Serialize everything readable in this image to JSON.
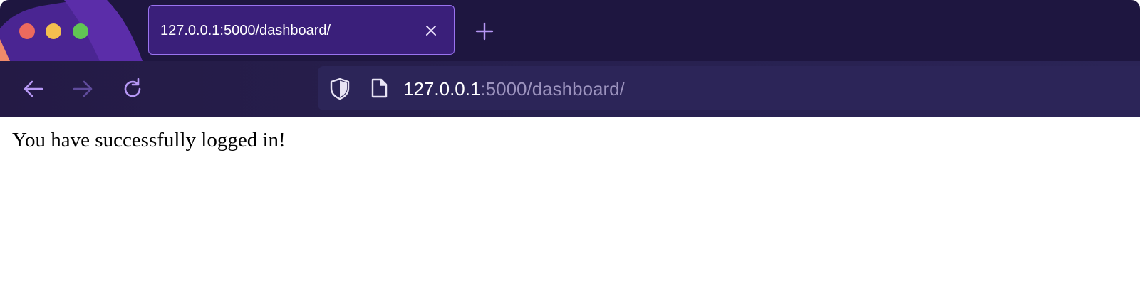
{
  "browser": {
    "tab": {
      "title": "127.0.0.1:5000/dashboard/",
      "close_icon": "close-icon"
    },
    "new_tab_icon": "plus-icon",
    "nav": {
      "back_icon": "arrow-left-icon",
      "forward_icon": "arrow-right-icon",
      "reload_icon": "reload-icon"
    },
    "urlbar": {
      "shield_icon": "shield-icon",
      "page_icon": "document-icon",
      "host": "127.0.0.1",
      "rest": ":5000/dashboard/"
    },
    "colors": {
      "tabstrip_bg": "#1e1640",
      "active_tab_bg": "#3a1f7a",
      "active_tab_border": "#9a73f0",
      "accent_icon": "#b697f5",
      "urlbar_bg": "#2c2558"
    }
  },
  "page": {
    "message": "You have successfully logged in!"
  }
}
